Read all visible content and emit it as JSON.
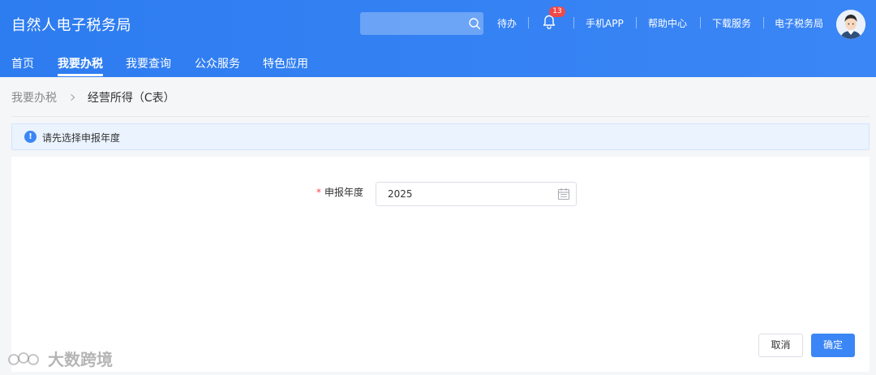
{
  "header": {
    "title": "自然人电子税务局",
    "search_placeholder": "",
    "links": {
      "todo": "待办",
      "notification_count": "13",
      "mobile_app": "手机APP",
      "help_center": "帮助中心",
      "download_service": "下载服务",
      "e_tax_bureau": "电子税务局"
    },
    "nav": [
      {
        "label": "首页"
      },
      {
        "label": "我要办税"
      },
      {
        "label": "我要查询"
      },
      {
        "label": "公众服务"
      },
      {
        "label": "特色应用"
      }
    ],
    "active_nav": "我要办税"
  },
  "breadcrumb": {
    "parent": "我要办税",
    "current": "经营所得（C表）"
  },
  "alert": {
    "icon": "info-icon",
    "text": "请先选择申报年度"
  },
  "form": {
    "required_mark": "*",
    "year_label": "申报年度",
    "year_value": "2025"
  },
  "actions": {
    "cancel": "取消",
    "confirm": "确定"
  },
  "watermark": {
    "text": "大数跨境"
  },
  "colors": {
    "primary": "#3b86f6",
    "badge": "#f04848",
    "alert_bg": "#eaf3fe"
  }
}
